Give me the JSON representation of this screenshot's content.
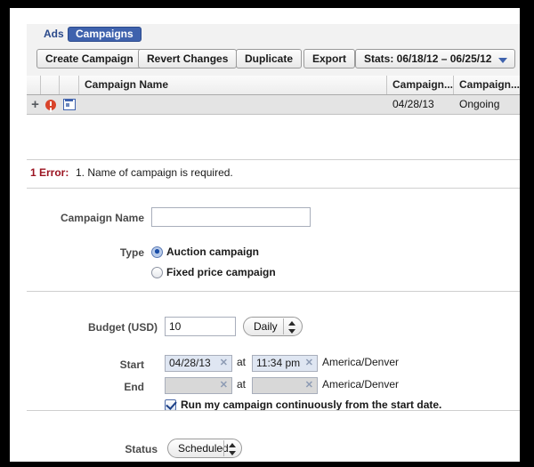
{
  "window": {
    "tabs": [
      {
        "name": "ads",
        "label": "Ads",
        "selected": false
      },
      {
        "name": "campaigns",
        "label": "Campaigns",
        "selected": true
      }
    ]
  },
  "toolbar": {
    "create_label": "Create Campaign",
    "revert_label": "Revert Changes",
    "duplicate_label": "Duplicate",
    "export_label": "Export",
    "stats_label": "Stats: 06/18/12 – 06/25/12",
    "stats_arrow_icon": "chevron-down-icon"
  },
  "table": {
    "columns": [
      "",
      "",
      "",
      "Campaign Name",
      "Campaign...",
      "Campaign..."
    ],
    "rows": [
      {
        "expand_icon": "plus-icon",
        "error_icon": "error-circle-icon",
        "calendar_icon": "calendar-icon",
        "name": "",
        "date": "04/28/13",
        "status": "Ongoing"
      }
    ]
  },
  "error": {
    "count_label": "1 Error:",
    "message": "1. Name of campaign is required.",
    "color": "#9b1421"
  },
  "form": {
    "campaign_name": {
      "label": "Campaign Name",
      "value": "",
      "placeholder": ""
    },
    "type": {
      "label": "Type",
      "options": [
        {
          "label": "Auction campaign",
          "selected": true
        },
        {
          "label": "Fixed price campaign",
          "selected": false
        }
      ]
    },
    "budget": {
      "label": "Budget (USD)",
      "value": "10",
      "period": "Daily"
    },
    "start": {
      "label": "Start",
      "date": "04/28/13",
      "at_label": "at",
      "time": "11:34 pm",
      "timezone": "America/Denver",
      "clear_icon": "clear-x-icon"
    },
    "end": {
      "label": "End",
      "date": "",
      "at_label": "at",
      "time": "",
      "timezone": "America/Denver",
      "clear_icon": "clear-x-icon"
    },
    "continuous": {
      "label": "Run my campaign continuously from the start date.",
      "checked": true
    },
    "status": {
      "label": "Status",
      "value": "Scheduled"
    }
  },
  "colors": {
    "accent": "#3f62ad",
    "titlebar": "#1f3c80",
    "error_red": "#9b1421",
    "error_icon": "#d9442b"
  }
}
